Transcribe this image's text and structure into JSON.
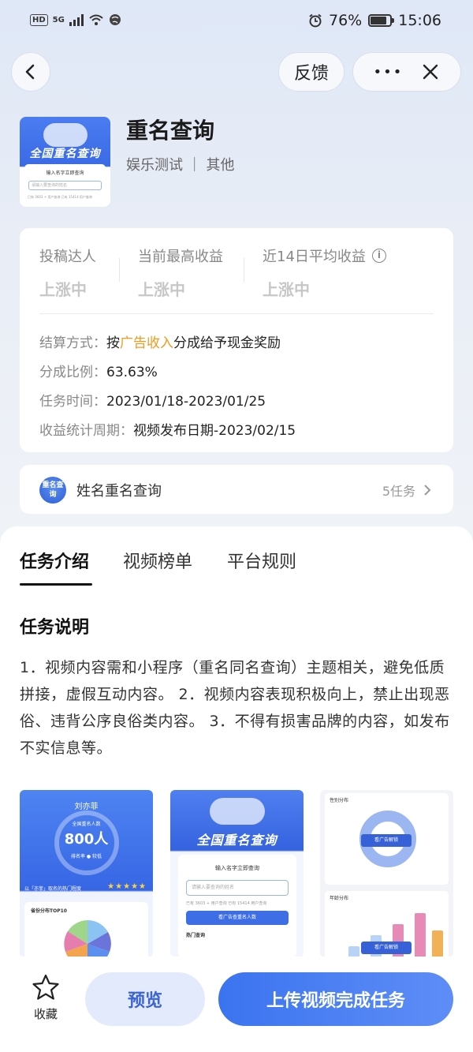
{
  "status_bar": {
    "network": "HD",
    "signal_type": "5G",
    "battery": "76%",
    "battery_level": 0.76,
    "time": "15:06"
  },
  "nav": {
    "feedback_label": "反馈",
    "more_label": "•••",
    "back_icon": "chevron-left-icon",
    "close_icon": "close-icon"
  },
  "app": {
    "title": "重名查询",
    "category": "娱乐测试 ｜ 其他",
    "thumb_title": "全国重名查询",
    "thumb_search": "输入名字立即查询",
    "thumb_placeholder": "请输入要查询的姓名",
    "thumb_note": "已有 3603 + 用户查询    已有 15414 用户查询"
  },
  "stats": [
    {
      "label": "投稿达人",
      "value": "上涨中"
    },
    {
      "label": "当前最高收益",
      "value": "上涨中"
    },
    {
      "label": "近14日平均收益",
      "value": "上涨中"
    }
  ],
  "details": {
    "settlement_key": "结算方式：",
    "settlement_pre": "按",
    "settlement_highlight": "广告收入",
    "settlement_post": "分成给予现金奖励",
    "ratio_key": "分成比例：",
    "ratio_value": "63.63%",
    "time_key": "任务时间：",
    "time_value": "2023/01/18-2023/01/25",
    "cycle_key": "收益统计周期：",
    "cycle_value": "视频发布日期-2023/02/15"
  },
  "series": {
    "icon_text": "重名查询",
    "name": "姓名重名查询",
    "count": "5任务"
  },
  "tabs": [
    {
      "label": "任务介绍",
      "active": true
    },
    {
      "label": "视频榜单",
      "active": false
    },
    {
      "label": "平台规则",
      "active": false
    }
  ],
  "section": {
    "title": "任务说明",
    "body": "1．视频内容需和小程序（重名同名查询）主题相关，避免低质拼接，虚假互动内容。 2．视频内容表现积极向上，禁止出现恶俗、违背公序良俗类内容。 3．不得有损害品牌的内容，如发布不实信息等。"
  },
  "screenshots": {
    "s1": {
      "name": "刘亦菲",
      "label": "全国重名人数",
      "value": "800人",
      "rank": "排名率   ●  较低",
      "heat": "以「亦菲」取名的热门程度",
      "stars": "★★★★★",
      "panel_title": "省份分布TOP10"
    },
    "s2": {
      "title": "全国重名查询",
      "search": "输入名字立即查询",
      "placeholder": "请输入要查询的姓名",
      "note": "已有 3603 + 用户查询    已有 15414 用户查询",
      "button": "看广告查重名人数",
      "hot": "热门查询"
    },
    "s3": {
      "gender_title": "性别分布",
      "age_title": "年龄分布",
      "button": "看广告解锁"
    }
  },
  "bottom": {
    "favorite_label": "收藏",
    "preview_label": "预览",
    "upload_label": "上传视频完成任务"
  },
  "colors": {
    "accent": "#3b74f0",
    "highlight": "#f29b1b",
    "muted_value": "#c7c7c7"
  }
}
